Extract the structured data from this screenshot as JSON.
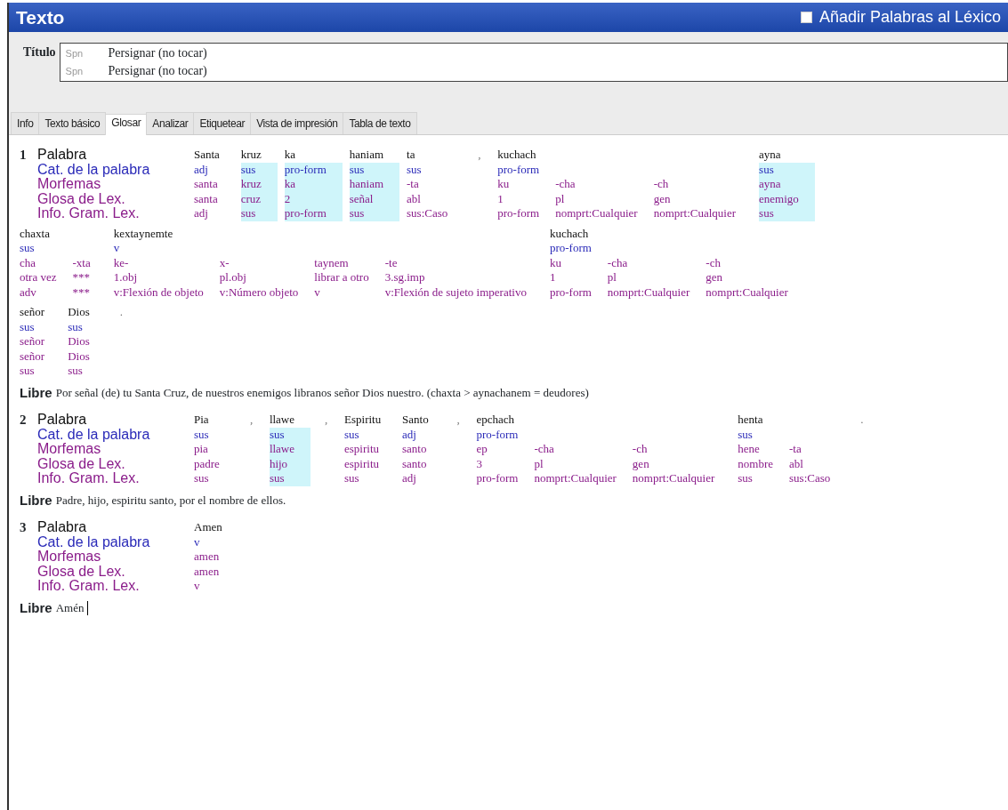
{
  "window": {
    "title": "Texto"
  },
  "lexicon_option": {
    "label": "Añadir Palabras al Léxico",
    "checked": false
  },
  "title_field": {
    "label": "Título",
    "rows": [
      {
        "language": "Spn",
        "value": "Persignar (no tocar)"
      },
      {
        "language": "Spn",
        "value": "Persignar (no tocar)"
      }
    ]
  },
  "tabs": [
    {
      "label": "Info",
      "selected": false
    },
    {
      "label": "Texto básico",
      "selected": false
    },
    {
      "label": "Glosar",
      "selected": true
    },
    {
      "label": "Analizar",
      "selected": false
    },
    {
      "label": "Etiquetear",
      "selected": false
    },
    {
      "label": "Vista de impresión",
      "selected": false
    },
    {
      "label": "Tabla de texto",
      "selected": false
    }
  ],
  "segments": [
    {
      "number": "1",
      "labels": [
        {
          "text": "Palabra",
          "kind": "word"
        },
        {
          "text": "Cat. de la palabra",
          "kind": "category"
        },
        {
          "text": "Morfemas",
          "kind": "morpheme"
        },
        {
          "text": "Glosa de Lex.",
          "kind": "gloss"
        },
        {
          "text": "Info. Gram. Lex.",
          "kind": "gram"
        }
      ],
      "lines": [
        {
          "words": [
            {
              "kind": "word",
              "word": "Santa",
              "category": "adj",
              "highlighted": false,
              "morphemes": [
                {
                  "form": "santa",
                  "gloss": "santa",
                  "gram": "adj"
                }
              ]
            },
            {
              "kind": "word",
              "word": "kruz",
              "category": "sus",
              "highlighted": true,
              "morphemes": [
                {
                  "form": "kruz",
                  "gloss": "cruz",
                  "gram": "sus"
                }
              ]
            },
            {
              "kind": "word",
              "word": "ka",
              "category": "pro-form",
              "highlighted": true,
              "morphemes": [
                {
                  "form": "ka",
                  "gloss": "2",
                  "gram": "pro-form"
                }
              ]
            },
            {
              "kind": "word",
              "word": "haniam",
              "category": "sus",
              "highlighted": true,
              "morphemes": [
                {
                  "form": "haniam",
                  "gloss": "señal",
                  "gram": "sus"
                }
              ]
            },
            {
              "kind": "word",
              "word": "ta",
              "category": "sus",
              "highlighted": false,
              "morphemes": [
                {
                  "form": "-ta",
                  "gloss": "abl",
                  "gram": "sus:Caso"
                }
              ]
            },
            {
              "kind": "punctuation",
              "word": ","
            },
            {
              "kind": "word",
              "word": "kuchach",
              "category": "pro-form",
              "highlighted": false,
              "morphemes": [
                {
                  "form": "ku",
                  "gloss": "1",
                  "gram": "pro-form"
                },
                {
                  "form": "-cha",
                  "gloss": "pl",
                  "gram": "nomprt:Cualquier"
                },
                {
                  "form": "-ch",
                  "gloss": "gen",
                  "gram": "nomprt:Cualquier"
                }
              ]
            },
            {
              "kind": "word",
              "word": "ayna",
              "category": "sus",
              "highlighted": true,
              "morphemes": [
                {
                  "form": "ayna",
                  "gloss": "enemigo",
                  "gram": "sus"
                }
              ]
            }
          ]
        },
        {
          "words": [
            {
              "kind": "word",
              "word": "chaxta",
              "category": "sus",
              "highlighted": false,
              "morphemes": [
                {
                  "form": "cha",
                  "gloss": "otra vez",
                  "gram": "adv"
                },
                {
                  "form": "-xta",
                  "gloss": "***",
                  "gram": "***"
                }
              ]
            },
            {
              "kind": "word",
              "word": "kextaynemte",
              "category": "v",
              "highlighted": false,
              "morphemes": [
                {
                  "form": "ke-",
                  "gloss": "1.obj",
                  "gram": "v:Flexión de objeto"
                },
                {
                  "form": "x-",
                  "gloss": "pl.obj",
                  "gram": "v:Número objeto"
                },
                {
                  "form": "taynem",
                  "gloss": "librar a otro",
                  "gram": "v"
                },
                {
                  "form": "-te",
                  "gloss": "3.sg.imp",
                  "gram": "v:Flexión de sujeto imperativo"
                }
              ]
            },
            {
              "kind": "word",
              "word": "kuchach",
              "category": "pro-form",
              "highlighted": false,
              "morphemes": [
                {
                  "form": "ku",
                  "gloss": "1",
                  "gram": "pro-form"
                },
                {
                  "form": "-cha",
                  "gloss": "pl",
                  "gram": "nomprt:Cualquier"
                },
                {
                  "form": "-ch",
                  "gloss": "gen",
                  "gram": "nomprt:Cualquier"
                }
              ]
            }
          ]
        },
        {
          "words": [
            {
              "kind": "word",
              "word": "señor",
              "category": "sus",
              "highlighted": false,
              "morphemes": [
                {
                  "form": "señor",
                  "gloss": "señor",
                  "gram": "sus"
                }
              ]
            },
            {
              "kind": "word",
              "word": "Dios",
              "category": "sus",
              "highlighted": false,
              "morphemes": [
                {
                  "form": "Dios",
                  "gloss": "Dios",
                  "gram": "sus"
                }
              ]
            },
            {
              "kind": "punctuation",
              "word": "."
            }
          ]
        }
      ],
      "free": {
        "label": "Libre",
        "text": "Por señal (de) tu Santa Cruz, de nuestros enemigos libranos señor Dios nuestro. (chaxta > aynachanem = deudores)",
        "cursor": false
      }
    },
    {
      "number": "2",
      "labels": [
        {
          "text": "Palabra",
          "kind": "word"
        },
        {
          "text": "Cat. de la palabra",
          "kind": "category"
        },
        {
          "text": "Morfemas",
          "kind": "morpheme"
        },
        {
          "text": "Glosa de Lex.",
          "kind": "gloss"
        },
        {
          "text": "Info. Gram. Lex.",
          "kind": "gram"
        }
      ],
      "lines": [
        {
          "words": [
            {
              "kind": "word",
              "word": "Pia",
              "category": "sus",
              "highlighted": false,
              "morphemes": [
                {
                  "form": "pia",
                  "gloss": "padre",
                  "gram": "sus"
                }
              ]
            },
            {
              "kind": "punctuation",
              "word": ","
            },
            {
              "kind": "word",
              "word": "llawe",
              "category": "sus",
              "highlighted": true,
              "morphemes": [
                {
                  "form": "llawe",
                  "gloss": "hijo",
                  "gram": "sus"
                }
              ]
            },
            {
              "kind": "punctuation",
              "word": ","
            },
            {
              "kind": "word",
              "word": "Espiritu",
              "category": "sus",
              "highlighted": false,
              "morphemes": [
                {
                  "form": "espiritu",
                  "gloss": "espiritu",
                  "gram": "sus"
                }
              ]
            },
            {
              "kind": "word",
              "word": "Santo",
              "category": "adj",
              "highlighted": false,
              "morphemes": [
                {
                  "form": "santo",
                  "gloss": "santo",
                  "gram": "adj"
                }
              ]
            },
            {
              "kind": "punctuation",
              "word": ","
            },
            {
              "kind": "word",
              "word": "epchach",
              "category": "pro-form",
              "highlighted": false,
              "morphemes": [
                {
                  "form": "ep",
                  "gloss": "3",
                  "gram": "pro-form"
                },
                {
                  "form": "-cha",
                  "gloss": "pl",
                  "gram": "nomprt:Cualquier"
                },
                {
                  "form": "-ch",
                  "gloss": "gen",
                  "gram": "nomprt:Cualquier"
                }
              ]
            },
            {
              "kind": "word",
              "word": "henta",
              "category": "sus",
              "highlighted": false,
              "morphemes": [
                {
                  "form": "hene",
                  "gloss": "nombre",
                  "gram": "sus"
                },
                {
                  "form": "-ta",
                  "gloss": "abl",
                  "gram": "sus:Caso"
                }
              ]
            },
            {
              "kind": "punctuation",
              "word": "."
            }
          ]
        }
      ],
      "free": {
        "label": "Libre",
        "text": "Padre, hijo, espiritu santo, por el nombre de ellos.",
        "cursor": false
      }
    },
    {
      "number": "3",
      "labels": [
        {
          "text": "Palabra",
          "kind": "word"
        },
        {
          "text": "Cat. de la palabra",
          "kind": "category"
        },
        {
          "text": "Morfemas",
          "kind": "morpheme"
        },
        {
          "text": "Glosa de Lex.",
          "kind": "gloss"
        },
        {
          "text": "Info. Gram. Lex.",
          "kind": "gram"
        }
      ],
      "lines": [
        {
          "words": [
            {
              "kind": "word",
              "word": "Amen",
              "category": "v",
              "highlighted": false,
              "morphemes": [
                {
                  "form": "amen",
                  "gloss": "amen",
                  "gram": "v"
                }
              ]
            }
          ]
        }
      ],
      "free": {
        "label": "Libre",
        "text": "Amén",
        "cursor": true
      }
    }
  ]
}
